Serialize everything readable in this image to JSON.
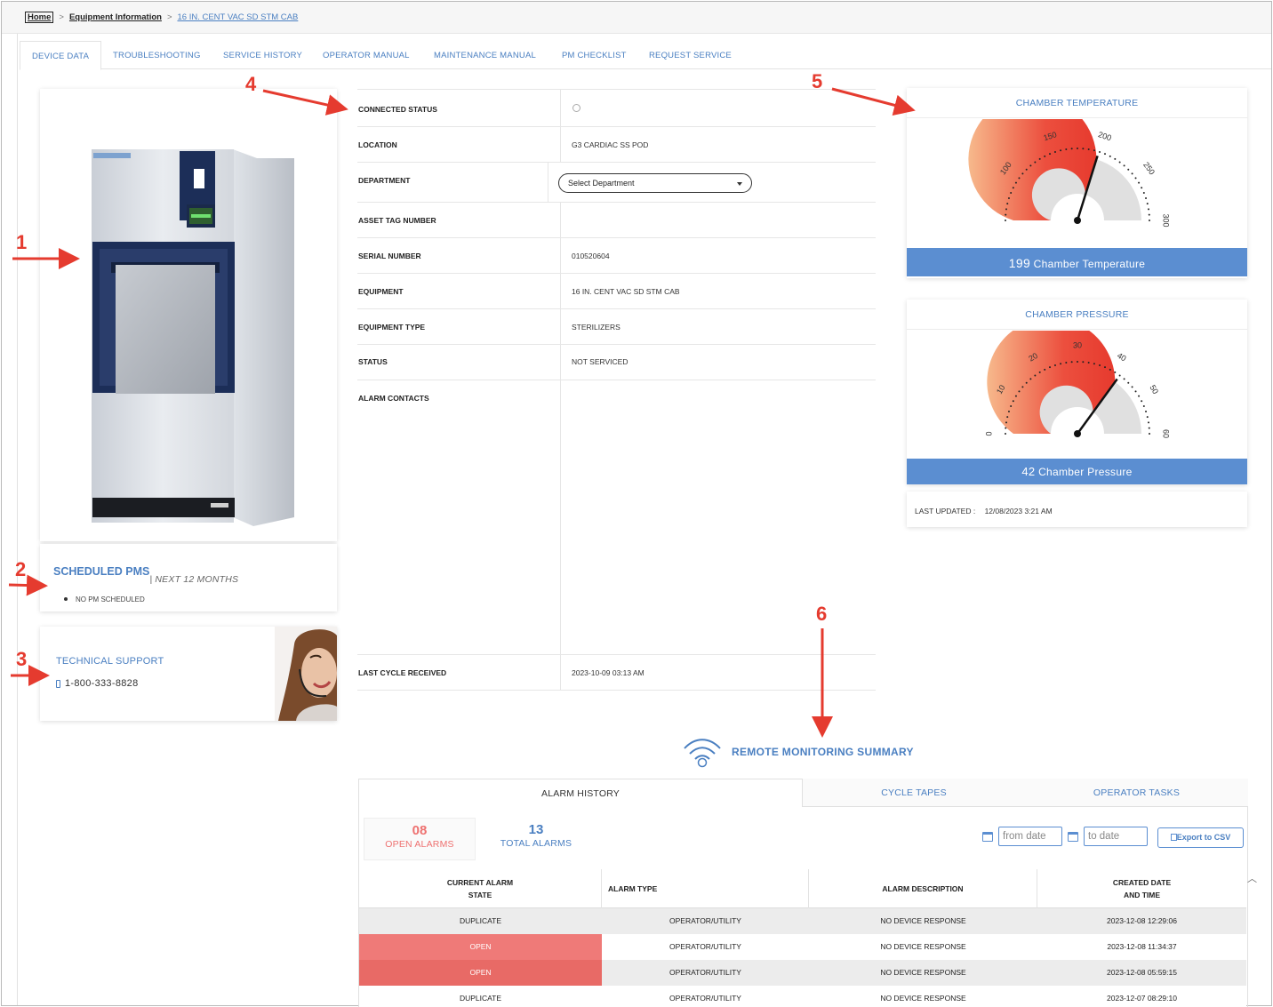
{
  "breadcrumb": {
    "home": "Home",
    "equipment_info": "Equipment Information",
    "current": "16 IN. CENT VAC SD STM CAB",
    "separator": ">"
  },
  "tabs": [
    "DEVICE DATA",
    "TROUBLESHOOTING",
    "SERVICE HISTORY",
    "OPERATOR MANUAL",
    "MAINTENANCE MANUAL",
    "PM CHECKLIST",
    "REQUEST SERVICE"
  ],
  "annotations": [
    "1",
    "2",
    "3",
    "4",
    "5",
    "6"
  ],
  "scheduled_pms": {
    "title": "SCHEDULED PMS",
    "subtitle": "| NEXT 12 MONTHS",
    "items": [
      "NO PM SCHEDULED"
    ]
  },
  "technical_support": {
    "title": "TECHNICAL SUPPORT",
    "phone": "1-800-333-8828"
  },
  "device_info": {
    "connected_status": {
      "label": "CONNECTED STATUS",
      "value": ""
    },
    "location": {
      "label": "LOCATION",
      "value": "G3 CARDIAC SS POD"
    },
    "department": {
      "label": "DEPARTMENT",
      "value": "Select Department"
    },
    "asset_tag": {
      "label": "ASSET TAG NUMBER",
      "value": ""
    },
    "serial": {
      "label": "SERIAL NUMBER",
      "value": "010520604"
    },
    "equipment": {
      "label": "EQUIPMENT",
      "value": "16 IN. CENT VAC SD STM CAB"
    },
    "equipment_type": {
      "label": "EQUIPMENT TYPE",
      "value": "STERILIZERS"
    },
    "status": {
      "label": "STATUS",
      "value": "NOT SERVICED"
    },
    "alarm_contacts": {
      "label": "ALARM CONTACTS",
      "value": ""
    },
    "last_cycle": {
      "label": "LAST CYCLE RECEIVED",
      "value": "2023-10-09 03:13 AM"
    }
  },
  "temperature_gauge": {
    "title": "CHAMBER TEMPERATURE",
    "value": "199",
    "label": "Chamber Temperature",
    "min": 50,
    "max": 300,
    "reading": 199,
    "ticks": [
      "100",
      "150",
      "200",
      "250",
      "300"
    ]
  },
  "pressure_gauge": {
    "title": "CHAMBER PRESSURE",
    "value": "42",
    "label": "Chamber Pressure",
    "min": 0,
    "max": 60,
    "reading": 42,
    "ticks": [
      "0",
      "10",
      "20",
      "30",
      "40",
      "50",
      "60"
    ]
  },
  "last_updated": {
    "label": "LAST UPDATED :",
    "value": "12/08/2023 3:21 AM"
  },
  "remote_monitoring": {
    "title": "REMOTE MONITORING SUMMARY",
    "tabs": [
      "ALARM HISTORY",
      "CYCLE TAPES",
      "OPERATOR TASKS"
    ],
    "open_alarms": {
      "count": "08",
      "label": "OPEN ALARMS"
    },
    "total_alarms": {
      "count": "13",
      "label": "TOTAL ALARMS"
    },
    "from_placeholder": "from date",
    "to_placeholder": "to date",
    "export_label": "Export to CSV"
  },
  "alarm_table": {
    "headers": [
      "CURRENT ALARM STATE",
      "ALARM TYPE",
      "ALARM DESCRIPTION",
      "CREATED DATE AND TIME"
    ],
    "rows": [
      [
        "DUPLICATE",
        "OPERATOR/UTILITY",
        "NO DEVICE RESPONSE",
        "2023-12-08 12:29:06"
      ],
      [
        "OPEN",
        "OPERATOR/UTILITY",
        "NO DEVICE RESPONSE",
        "2023-12-08 11:34:37"
      ],
      [
        "OPEN",
        "OPERATOR/UTILITY",
        "NO DEVICE RESPONSE",
        "2023-12-08 05:59:15"
      ],
      [
        "DUPLICATE",
        "OPERATOR/UTILITY",
        "NO DEVICE RESPONSE",
        "2023-12-07 08:29:10"
      ]
    ]
  },
  "colors": {
    "accent": "#4a7fc1",
    "bar": "#5b8ed1",
    "annotation": "#e53b2f",
    "open_row": "#ee7170",
    "gauge_fill": "#ec4f3e",
    "gauge_track": "#e0e0e0"
  }
}
